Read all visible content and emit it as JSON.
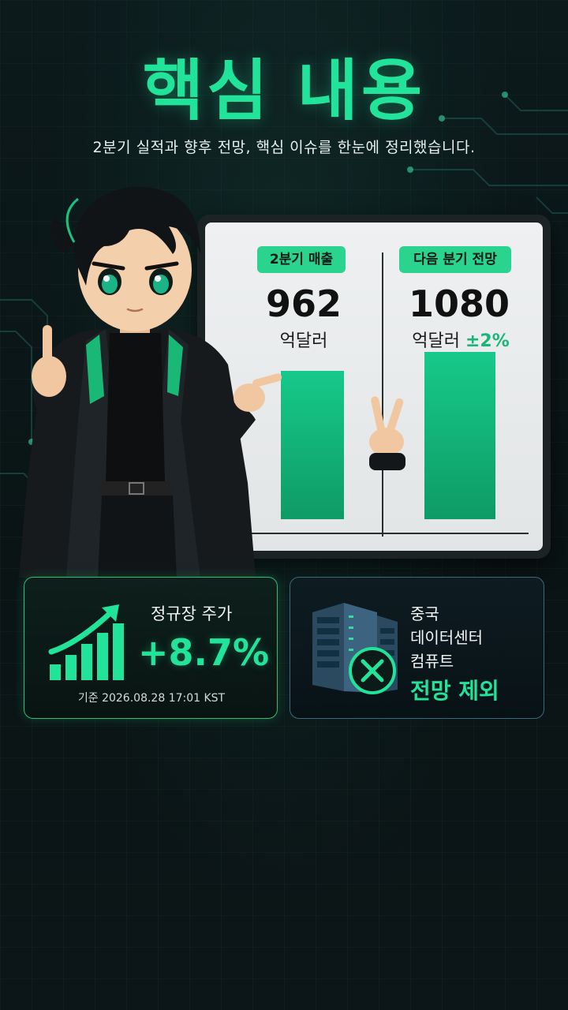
{
  "header": {
    "title": "핵심 내용",
    "subtitle": "2분기 실적과 향후 전망, 핵심 이슈를 한눈에 정리했습니다."
  },
  "board": {
    "left": {
      "label": "2분기 매출",
      "value": "962",
      "unit": "억달러"
    },
    "right": {
      "label": "다음 분기 전망",
      "value": "1080",
      "unit": "억달러",
      "extra": "±2%"
    }
  },
  "chart_data": {
    "type": "bar",
    "categories": [
      "2분기 매출",
      "다음 분기 전망"
    ],
    "values": [
      962,
      1080
    ],
    "ylim": [
      0,
      1200
    ]
  },
  "stock_card": {
    "label": "정규장 주가",
    "value": "+8.7%",
    "note": "기준 2026.08.28 17:01 KST"
  },
  "china_card": {
    "lines": [
      "중국",
      "데이터센터",
      "컴퓨트"
    ],
    "emphasis": "전망 제외"
  },
  "colors": {
    "accent": "#22e39a",
    "bar": "#14b97e",
    "background": "#0a1214"
  }
}
